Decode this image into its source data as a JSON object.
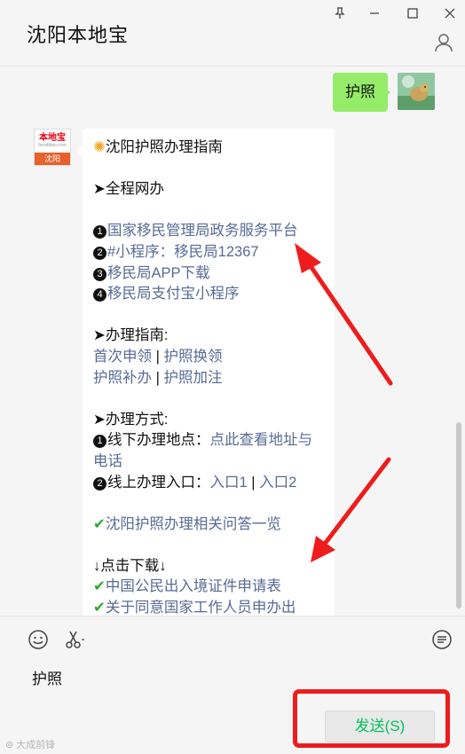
{
  "window": {
    "title": "沈阳本地宝",
    "controls": {
      "pin": "pin-icon",
      "minimize": "minimize-icon",
      "maximize": "maximize-icon",
      "close": "close-icon"
    }
  },
  "chat": {
    "sent_message": "护照",
    "bot_avatar": {
      "logo_text": "本地宝",
      "logo_subtext": "bendibao.com",
      "city": "沈阳"
    },
    "reply": {
      "title": "沈阳护照办理指南",
      "online_heading": "➤全程网办",
      "online_items": [
        {
          "num": "1",
          "text": "国家移民管理局政务服务平台"
        },
        {
          "num": "2",
          "text": "#小程序：移民局12367"
        },
        {
          "num": "3",
          "text": "移民局APP下载"
        },
        {
          "num": "4",
          "text": "移民局支付宝小程序"
        }
      ],
      "guide_heading": "➤办理指南:",
      "guide_links": [
        "首次申领",
        "护照换领",
        "护照补办",
        "护照加注"
      ],
      "separator": "|",
      "method_heading": "➤办理方式:",
      "offline_label": "线下办理地点：",
      "offline_link": "点此查看地址与电话",
      "online_label": "线上办理入口：",
      "entry_links": [
        "入口1",
        "入口2"
      ],
      "faq_link": "沈阳护照办理相关问答一览",
      "download_heading": "↓点击下载↓",
      "download_links": [
        "中国公民出入境证件申请表",
        "关于同意国家工作人员申办出"
      ]
    }
  },
  "input": {
    "text": "护照",
    "send_label": "发送(S)",
    "toolbar": {
      "emoji": "emoji-icon",
      "screenshot": "scissors-icon",
      "history": "chat-history-icon"
    },
    "watermark": "大成前锋"
  },
  "colors": {
    "accent_green": "#95ec69",
    "link": "#576b95",
    "send_text": "#07c160",
    "annotation_red": "#ee1c1c"
  }
}
